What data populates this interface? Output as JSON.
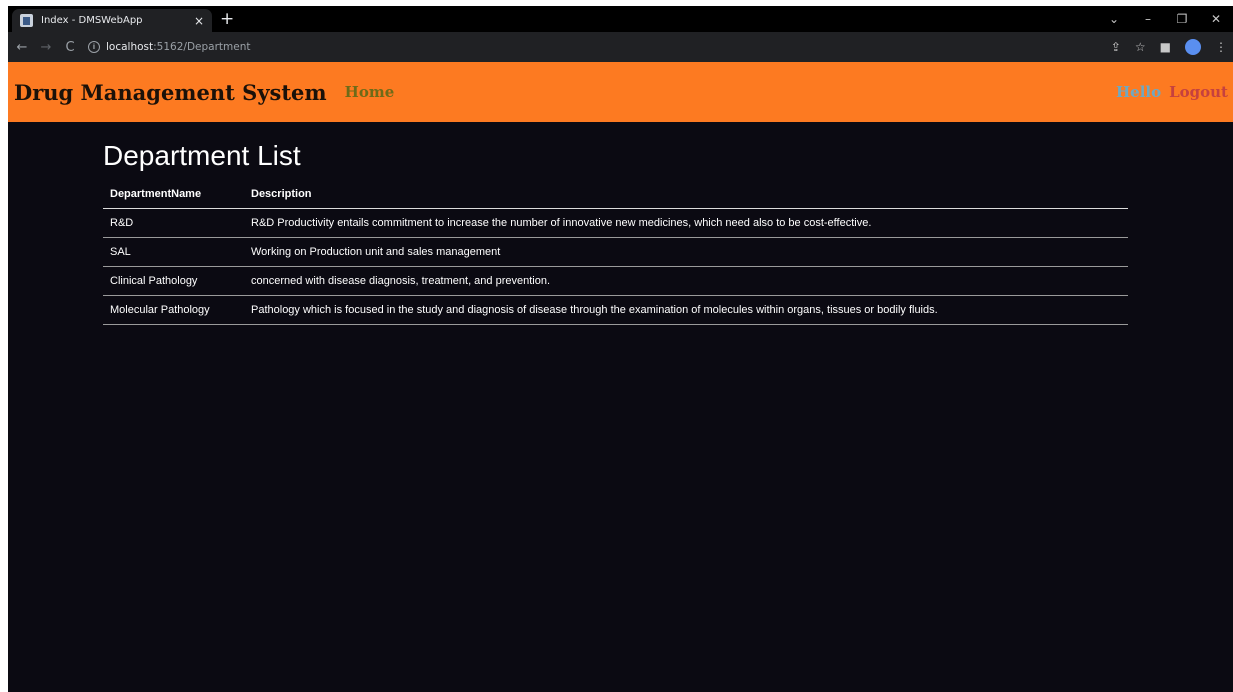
{
  "browser": {
    "tab_title": "Index - DMSWebApp",
    "tab_close": "×",
    "new_tab": "+",
    "url_host": "localhost",
    "url_path": ":5162/Department",
    "window_controls": {
      "minimize": "–",
      "maximize": "❐",
      "close": "✕",
      "tab_search": "⌄"
    }
  },
  "header": {
    "brand": "Drug Management System",
    "home": "Home",
    "hello": "Hello",
    "logout": "Logout"
  },
  "page": {
    "title": "Department List"
  },
  "table": {
    "headers": [
      "DepartmentName",
      "Description"
    ],
    "rows": [
      [
        "R&D",
        "R&D Productivity entails commitment to increase the number of innovative new medicines, which need also to be cost-effective."
      ],
      [
        "SAL",
        "Working on Production unit and sales management"
      ],
      [
        "Clinical Pathology",
        "concerned with disease diagnosis, treatment, and prevention."
      ],
      [
        "Molecular Pathology",
        "Pathology which is focused in the study and diagnosis of disease through the examination of molecules within organs, tissues or bodily fluids."
      ]
    ]
  },
  "colors": {
    "header_bg": "#fd7a21",
    "page_bg": "#0b0a12",
    "home_link": "#6e6b18",
    "hello_link": "#6fa8c2",
    "logout_link": "#c6413e"
  }
}
